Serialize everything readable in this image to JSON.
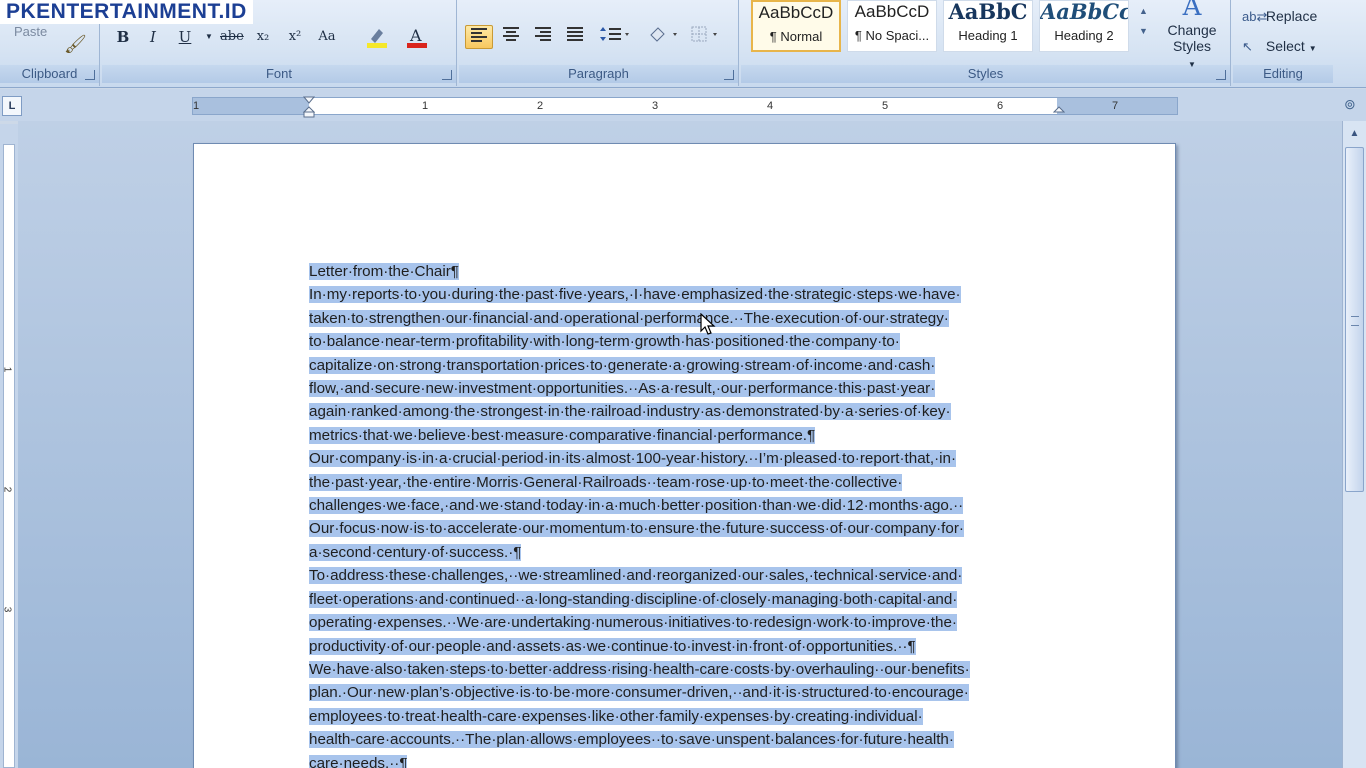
{
  "watermark": "PKENTERTAINMENT.ID",
  "ribbon": {
    "clipboard": {
      "paste_label": "Paste",
      "group_label": "Clipboard"
    },
    "font": {
      "group_label": "Font",
      "bold": "B",
      "italic": "I",
      "underline": "U",
      "strikethrough": "abe",
      "subscript": "x₂",
      "superscript": "x²",
      "change_case": "Aa",
      "highlight_color": "#f5e82a",
      "font_color": "#d9241c"
    },
    "paragraph": {
      "group_label": "Paragraph"
    },
    "styles": {
      "group_label": "Styles",
      "tiles": [
        {
          "preview": "AaBbCcD",
          "name": "¶ Normal",
          "active": true
        },
        {
          "preview": "AaBbCcD",
          "name": "¶ No Spaci...",
          "active": false
        },
        {
          "preview": "AaBbC",
          "name": "Heading 1",
          "active": false
        },
        {
          "preview": "AaBbCc",
          "name": "Heading 2",
          "active": false
        }
      ],
      "change_styles": "Change Styles"
    },
    "editing": {
      "group_label": "Editing",
      "replace": "Replace",
      "select": "Select"
    }
  },
  "ruler": {
    "numbers": [
      "1",
      "1",
      "2",
      "3",
      "4",
      "5",
      "6",
      "7"
    ]
  },
  "vruler": {
    "numbers": [
      "1",
      "2",
      "3"
    ]
  },
  "document": {
    "paragraphs": [
      [
        "Letter·from·the·Chair¶"
      ],
      [
        "In·my·reports·to·you·during·the·past·five·years,·I·have·emphasized·the·strategic·steps·we·have·",
        "taken·to·strengthen·our·financial·and·operational·performance.··The·execution·of·our·strategy·",
        "to·balance·near-term·profitability·with·long-term·growth·has·positioned·the·company·to·",
        "capitalize·on·strong·transportation·prices·to·generate·a·growing·stream·of·income·and·cash·",
        "flow,·and·secure·new·investment·opportunities.··As·a·result,·our·performance·this·past·year·",
        "again·ranked·among·the·strongest·in·the·railroad·industry·as·demonstrated·by·a·series·of·key·",
        "metrics·that·we·believe·best·measure·comparative·financial·performance.¶"
      ],
      [
        "Our·company·is·in·a·crucial·period·in·its·almost·100-year·history.··I’m·pleased·to·report·that,·in·",
        "the·past·year,·the·entire·Morris·General·Railroads··team·rose·up·to·meet·the·collective·",
        "challenges·we·face,·and·we·stand·today·in·a·much·better·position·than·we·did·12·months·ago.··",
        "Our·focus·now·is·to·accelerate·our·momentum·to·ensure·the·future·success·of·our·company·for·",
        "a·second·century·of·success.·¶"
      ],
      [
        "To·address·these·challenges,··we·streamlined·and·reorganized·our·sales,·technical·service·and·",
        "fleet·operations·and·continued··a·long-standing·discipline·of·closely·managing·both·capital·and·",
        "operating·expenses.··We·are·undertaking·numerous·initiatives·to·redesign·work·to·improve·the·",
        "productivity·of·our·people·and·assets·as·we·continue·to·invest·in·front·of·opportunities.··¶"
      ],
      [
        "We·have·also·taken·steps·to·better·address·rising·health-care·costs·by·overhauling··our·benefits·",
        "plan.·Our·new·plan’s·objective·is·to·be·more·consumer-driven,··and·it·is·structured·to·encourage·",
        "employees·to·treat·health-care·expenses·like·other·family·expenses·by·creating·individual·",
        "health-care·accounts.··The·plan·allows·employees··to·save·unspent·balances·for·future·health·",
        "care·needs.··¶"
      ]
    ]
  }
}
